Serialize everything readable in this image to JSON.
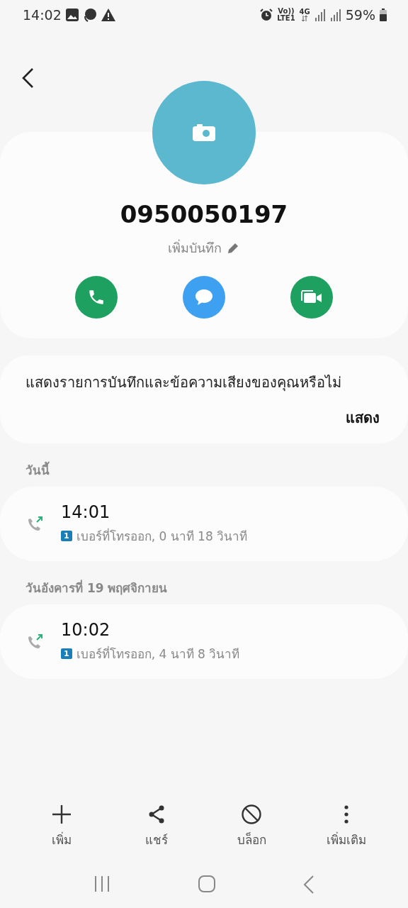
{
  "status_bar": {
    "time": "14:02",
    "volte": "Vo))",
    "lte": "LTE1",
    "network": "4G",
    "battery": "59%"
  },
  "contact": {
    "number": "0950050197",
    "note_label": "เพิ่มบันทึก"
  },
  "actions": [
    {
      "kind": "call"
    },
    {
      "kind": "message"
    },
    {
      "kind": "video"
    }
  ],
  "banner": {
    "text": "แสดงรายการบันทึกและข้อความเสียงของคุณหรือไม่",
    "button": "แสดง"
  },
  "history": [
    {
      "date": "วันนี้",
      "calls": [
        {
          "time": "14:01",
          "sim": "1",
          "detail": "เบอร์ที่โทรออก, 0 นาที 18 วินาที"
        }
      ]
    },
    {
      "date": "วันอังคารที่ 19 พฤศจิกายน",
      "calls": [
        {
          "time": "10:02",
          "sim": "1",
          "detail": "เบอร์ที่โทรออก, 4 นาที 8 วินาที"
        }
      ]
    }
  ],
  "bottom_bar": [
    {
      "kind": "add",
      "label": "เพิ่ม"
    },
    {
      "kind": "share",
      "label": "แชร์"
    },
    {
      "kind": "block",
      "label": "บล็อก"
    },
    {
      "kind": "more",
      "label": "เพิ่มเติม"
    }
  ]
}
